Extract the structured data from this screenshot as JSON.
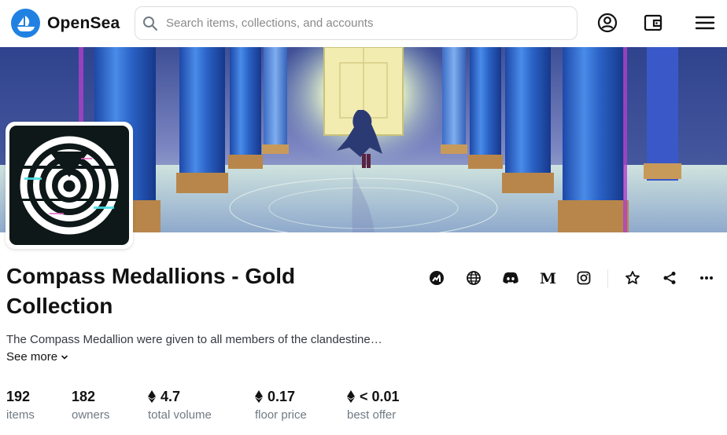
{
  "brand": {
    "name": "OpenSea",
    "accent": "#2081e2"
  },
  "header": {
    "search_placeholder": "Search items, collections, and accounts",
    "icons": [
      "search-icon",
      "account-icon",
      "wallet-icon",
      "menu-icon"
    ]
  },
  "collection": {
    "title": "Compass Medallions - Gold Collection",
    "description": "The Compass Medallion were given to all members of the clandestine…",
    "see_more": "See more",
    "links": [
      "activity-icon",
      "globe-icon",
      "discord-icon",
      "medium-icon",
      "instagram-icon",
      "star-icon",
      "share-icon",
      "more-icon"
    ]
  },
  "stats": [
    {
      "value": "192",
      "label": "items",
      "eth": false
    },
    {
      "value": "182",
      "label": "owners",
      "eth": false
    },
    {
      "value": "4.7",
      "label": "total volume",
      "eth": true
    },
    {
      "value": "0.17",
      "label": "floor price",
      "eth": true
    },
    {
      "value": "< 0.01",
      "label": "best offer",
      "eth": true
    }
  ]
}
